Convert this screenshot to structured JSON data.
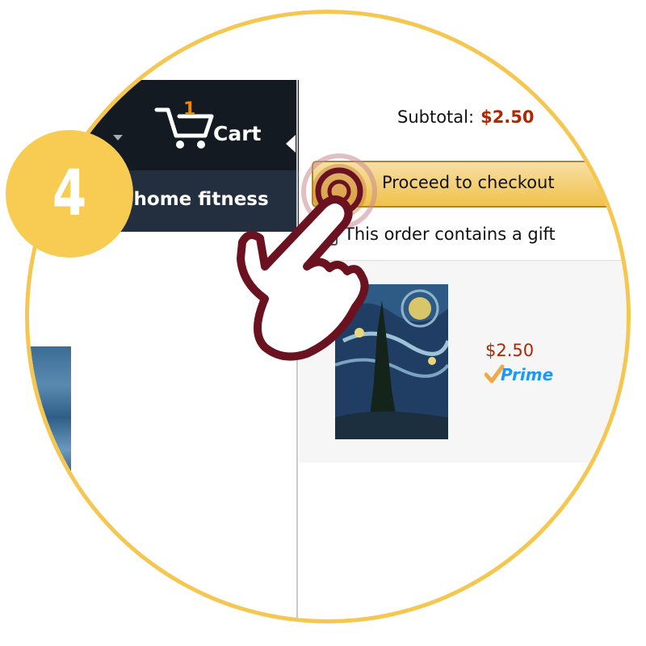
{
  "step": {
    "number": "4"
  },
  "nav": {
    "cart_count": "1",
    "cart_label": "Cart",
    "category": "-home fitness"
  },
  "cart": {
    "subtotal_label": "Subtotal:",
    "subtotal_value": "$2.50",
    "checkout_button": "Proceed to checkout",
    "gift_label": "This order contains a gift",
    "item": {
      "price": "$2.50",
      "prime_label": "Prime"
    }
  },
  "colors": {
    "accent_yellow": "#f8cb52",
    "price_red": "#b12704",
    "hand_outline": "#6b1220",
    "nav_dark": "#131a22",
    "nav_secondary": "#232f3e",
    "cart_count_orange": "#f08804",
    "prime_blue": "#1a98ff"
  },
  "icons": [
    "cart-icon",
    "dropdown-caret-icon",
    "tap-hand-icon",
    "prime-checkmark-icon"
  ]
}
